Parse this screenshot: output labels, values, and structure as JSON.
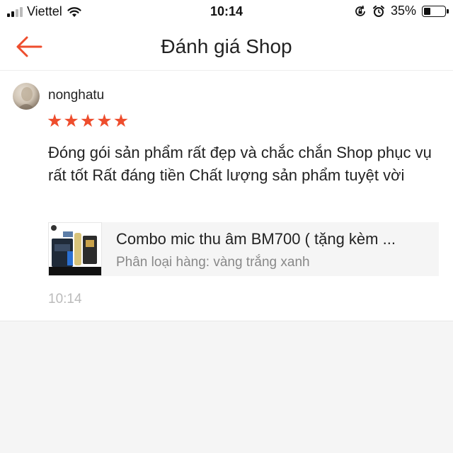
{
  "status_bar": {
    "carrier": "Viettel",
    "time": "10:14",
    "battery_percent": "35%",
    "battery_level": 0.35,
    "icons": [
      "signal-icon",
      "wifi-icon",
      "rotation-lock-icon",
      "alarm-icon",
      "battery-icon"
    ]
  },
  "header": {
    "title": "Đánh giá Shop",
    "back_icon": "arrow-left-icon",
    "accent_color": "#ee4d2d"
  },
  "review": {
    "username": "nonghatu",
    "rating": 5,
    "max_rating": 5,
    "star_color": "#ee4d2d",
    "text": "Đóng gói sản phẩm rất đẹp và chắc chắn Shop phục vụ rất tốt Rất đáng tiền Chất lượng sản phẩm tuyệt vời",
    "product": {
      "name": "Combo mic thu âm BM700 ( tặng kèm ...",
      "variant": "Phân loại hàng: vàng trắng xanh"
    },
    "time": "10:14"
  }
}
